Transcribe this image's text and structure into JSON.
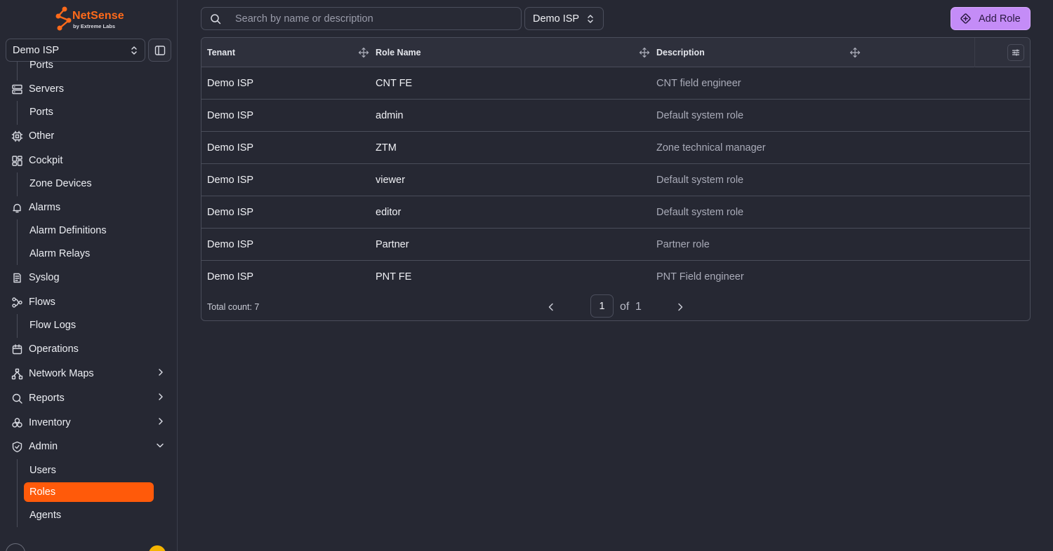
{
  "brand": {
    "name": "NetSense",
    "tagline": "by Extreme Labs",
    "accent_color": "#ff5a0a"
  },
  "sidebar": {
    "tenant_select": {
      "value": "Demo ISP"
    },
    "nav": [
      {
        "type": "sub",
        "label": "Ports"
      },
      {
        "type": "item",
        "label": "Servers",
        "icon": "server-icon"
      },
      {
        "type": "sub",
        "label": "Ports"
      },
      {
        "type": "item",
        "label": "Other",
        "icon": "cpu-icon"
      },
      {
        "type": "item",
        "label": "Cockpit",
        "icon": "dashboard-icon"
      },
      {
        "type": "sub",
        "label": "Zone Devices"
      },
      {
        "type": "item",
        "label": "Alarms",
        "icon": "bell-icon"
      },
      {
        "type": "sub",
        "label": "Alarm Definitions"
      },
      {
        "type": "sub",
        "label": "Alarm Relays"
      },
      {
        "type": "item",
        "label": "Syslog",
        "icon": "document-icon"
      },
      {
        "type": "item",
        "label": "Flows",
        "icon": "flow-icon"
      },
      {
        "type": "sub",
        "label": "Flow Logs"
      },
      {
        "type": "item",
        "label": "Operations",
        "icon": "calendar-icon"
      },
      {
        "type": "item",
        "label": "Network Maps",
        "icon": "network-icon",
        "chevron": "right"
      },
      {
        "type": "item",
        "label": "Reports",
        "icon": "search-icon",
        "chevron": "right"
      },
      {
        "type": "item",
        "label": "Inventory",
        "icon": "boxes-icon",
        "chevron": "right"
      },
      {
        "type": "item",
        "label": "Admin",
        "icon": "shield-icon",
        "chevron": "down"
      },
      {
        "type": "sub",
        "label": "Users"
      },
      {
        "type": "sub",
        "label": "Roles",
        "active": true
      },
      {
        "type": "sub",
        "label": "Agents"
      }
    ]
  },
  "toolbar": {
    "search_placeholder": "Search by name or description",
    "tenant_filter": "Demo ISP",
    "add_role_label": "Add Role"
  },
  "table": {
    "columns": [
      "Tenant",
      "Role Name",
      "Description"
    ],
    "rows": [
      {
        "tenant": "Demo ISP",
        "role": "CNT FE",
        "description": "CNT field engineer"
      },
      {
        "tenant": "Demo ISP",
        "role": "admin",
        "description": "Default system role"
      },
      {
        "tenant": "Demo ISP",
        "role": "ZTM",
        "description": "Zone technical manager"
      },
      {
        "tenant": "Demo ISP",
        "role": "viewer",
        "description": "Default system role"
      },
      {
        "tenant": "Demo ISP",
        "role": "editor",
        "description": "Default system role"
      },
      {
        "tenant": "Demo ISP",
        "role": "Partner",
        "description": "Partner role"
      },
      {
        "tenant": "Demo ISP",
        "role": "PNT FE",
        "description": "PNT Field engineer"
      }
    ],
    "total_count": "Total count: 7",
    "pagination": {
      "current": "1",
      "of_label": "of",
      "total": "1"
    }
  }
}
